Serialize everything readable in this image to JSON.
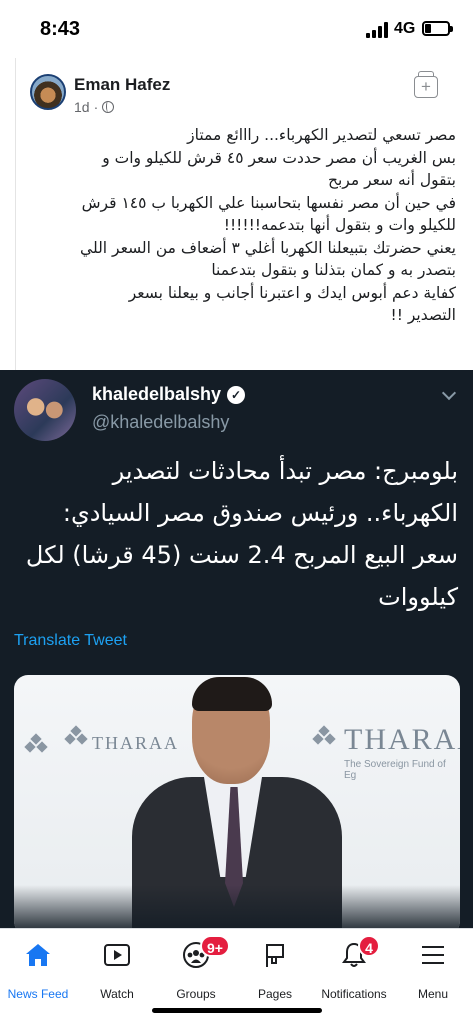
{
  "status_bar": {
    "time": "8:43",
    "network": "4G",
    "battery_percent": 20
  },
  "post": {
    "author": "Eman Hafez",
    "time": "1d",
    "lines": [
      "مصر تسعي لتصدير الكهرباء... رااائع ممتاز",
      "بس الغريب أن مصر حددت سعر ٤٥ قرش للكيلو وات و",
      "بتقول أنه سعر مربح",
      "في حين أن مصر نفسها بتحاسبنا علي الكهربا ب ١٤٥ قرش",
      "للكيلو وات و بتقول أنها بتدعمه!!!!!!",
      "يعني حضرتك بتبيعلنا الكهربا أغلي ٣ أضعاف من السعر اللي",
      "بتصدر به و كمان بتذلنا و بتقول بتدعمنا",
      "كفاية دعم أبوس ايدك و اعتبرنا أجانب و بيعلنا بسعر",
      "التصدير !!"
    ]
  },
  "tweet": {
    "name": "khaledelbalshy",
    "handle": "@khaledelbalshy",
    "lines": [
      "بلومبرج: مصر تبدأ محادثات لتصدير",
      "الكهرباء.. ورئيس صندوق مصر السيادي:",
      "سعر البيع المربح 2.4 سنت (45 قرشا) لكل",
      "كيلووات"
    ],
    "translate_label": "Translate Tweet",
    "photo_logo_small": "THARAA",
    "photo_logo_large": "THARAA",
    "photo_logo_sub": "The Sovereign Fund of Eg"
  },
  "tabbar": {
    "items": [
      {
        "label": "News Feed",
        "icon": "home-icon",
        "active": true
      },
      {
        "label": "Watch",
        "icon": "watch-icon",
        "active": false
      },
      {
        "label": "Groups",
        "icon": "groups-icon",
        "active": false,
        "badge": "9+"
      },
      {
        "label": "Pages",
        "icon": "pages-flag-icon",
        "active": false
      },
      {
        "label": "Notifications",
        "icon": "bell-icon",
        "active": false,
        "badge": "4"
      },
      {
        "label": "Menu",
        "icon": "menu-icon",
        "active": false
      }
    ]
  },
  "colors": {
    "accent": "#1877f2",
    "badge": "#e41e3f",
    "tweet_bg": "#141d26",
    "link": "#1da1f2"
  }
}
